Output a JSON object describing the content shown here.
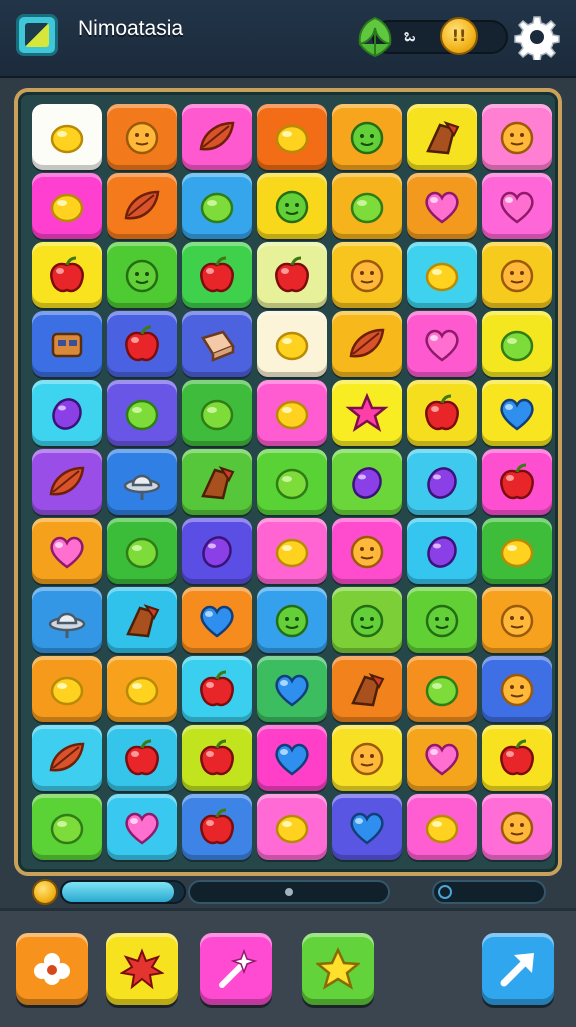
{
  "header": {
    "title": "Nimoatasia",
    "resource_count": "ಒ",
    "resource_icon": "leaf-icon",
    "coin_glyph": "!!",
    "coin_icon": "coin-icon",
    "settings_icon": "gear-icon"
  },
  "board": {
    "rows": 11,
    "cols": 7,
    "tiles": [
      [
        {
          "bg": "#fdfdf8",
          "icon": "lemon"
        },
        {
          "bg": "#f27a1c",
          "icon": "cookie"
        },
        {
          "bg": "#ff59cf",
          "icon": "leaf"
        },
        {
          "bg": "#f26d16",
          "icon": "lemon"
        },
        {
          "bg": "#f7a51d",
          "icon": "pea"
        },
        {
          "bg": "#f7e21f",
          "icon": "star-chip"
        },
        {
          "bg": "#ff7fd3",
          "icon": "cookie"
        }
      ],
      [
        {
          "bg": "#ff3fcf",
          "icon": "lemon"
        },
        {
          "bg": "#f57a1b",
          "icon": "leaf"
        },
        {
          "bg": "#35a6ec",
          "icon": "lime"
        },
        {
          "bg": "#f9d81c",
          "icon": "pea"
        },
        {
          "bg": "#f7b31c",
          "icon": "lime"
        },
        {
          "bg": "#f39a1e",
          "icon": "heart"
        },
        {
          "bg": "#ff66d8",
          "icon": "heart"
        }
      ],
      [
        {
          "bg": "#f9e31e",
          "icon": "apple"
        },
        {
          "bg": "#4ecb33",
          "icon": "pea"
        },
        {
          "bg": "#3fd04c",
          "icon": "apple"
        },
        {
          "bg": "#e7f19a",
          "icon": "apple"
        },
        {
          "bg": "#f7c51e",
          "icon": "cookie"
        },
        {
          "bg": "#3ed2ee",
          "icon": "lemon"
        },
        {
          "bg": "#f7ca1e",
          "icon": "cookie"
        }
      ],
      [
        {
          "bg": "#3b6fe3",
          "icon": "robot"
        },
        {
          "bg": "#4a62e1",
          "icon": "apple"
        },
        {
          "bg": "#4d62df",
          "icon": "gift"
        },
        {
          "bg": "#fbf4d8",
          "icon": "lemon"
        },
        {
          "bg": "#f7b81c",
          "icon": "leaf"
        },
        {
          "bg": "#ff59d0",
          "icon": "heart"
        },
        {
          "bg": "#f5e71f",
          "icon": "lime"
        }
      ],
      [
        {
          "bg": "#3ed4f0",
          "icon": "gem"
        },
        {
          "bg": "#6a56e6",
          "icon": "lime"
        },
        {
          "bg": "#3fbc3c",
          "icon": "lime"
        },
        {
          "bg": "#ff5cd1",
          "icon": "lemon"
        },
        {
          "bg": "#f8ed22",
          "icon": "star"
        },
        {
          "bg": "#f5de1e",
          "icon": "apple"
        },
        {
          "bg": "#f8e51f",
          "icon": "blueheart"
        }
      ],
      [
        {
          "bg": "#9a4ee8",
          "icon": "leaf"
        },
        {
          "bg": "#2f7fe4",
          "icon": "ufo"
        },
        {
          "bg": "#56c73a",
          "icon": "star-chip"
        },
        {
          "bg": "#59d236",
          "icon": "lime"
        },
        {
          "bg": "#6ad63a",
          "icon": "gem"
        },
        {
          "bg": "#3ec9ee",
          "icon": "gem"
        },
        {
          "bg": "#ff4fd1",
          "icon": "apple"
        }
      ],
      [
        {
          "bg": "#f5a11c",
          "icon": "heart"
        },
        {
          "bg": "#3bbd3a",
          "icon": "lime"
        },
        {
          "bg": "#5a4ee4",
          "icon": "gem"
        },
        {
          "bg": "#ff64d2",
          "icon": "lemon"
        },
        {
          "bg": "#ff4bce",
          "icon": "cookie"
        },
        {
          "bg": "#35c6ef",
          "icon": "gem"
        },
        {
          "bg": "#3dbd3a",
          "icon": "lemon"
        }
      ],
      [
        {
          "bg": "#3497e6",
          "icon": "ufo"
        },
        {
          "bg": "#30c2ea",
          "icon": "star-chip"
        },
        {
          "bg": "#f58c1d",
          "icon": "blueheart"
        },
        {
          "bg": "#35a1ec",
          "icon": "pea"
        },
        {
          "bg": "#7ccf36",
          "icon": "pea"
        },
        {
          "bg": "#60d035",
          "icon": "pea"
        },
        {
          "bg": "#f7a21e",
          "icon": "cookie"
        }
      ],
      [
        {
          "bg": "#f59a1b",
          "icon": "lemon"
        },
        {
          "bg": "#f7a11d",
          "icon": "lemon"
        },
        {
          "bg": "#3acfee",
          "icon": "apple"
        },
        {
          "bg": "#3cbd60",
          "icon": "blueheart"
        },
        {
          "bg": "#f2821b",
          "icon": "star-chip"
        },
        {
          "bg": "#f58f1d",
          "icon": "lime"
        },
        {
          "bg": "#3f6fe4",
          "icon": "cookie"
        }
      ],
      [
        {
          "bg": "#3ecff0",
          "icon": "leaf"
        },
        {
          "bg": "#35c5ea",
          "icon": "apple"
        },
        {
          "bg": "#c2e41f",
          "icon": "apple"
        },
        {
          "bg": "#ff3fc7",
          "icon": "blueheart"
        },
        {
          "bg": "#f8e124",
          "icon": "cookie"
        },
        {
          "bg": "#f5a51b",
          "icon": "heart"
        },
        {
          "bg": "#f8e21f",
          "icon": "apple"
        }
      ],
      [
        {
          "bg": "#5bd236",
          "icon": "lime"
        },
        {
          "bg": "#39c9f0",
          "icon": "heart"
        },
        {
          "bg": "#3d84e6",
          "icon": "apple"
        },
        {
          "bg": "#ff6ad5",
          "icon": "lemon"
        },
        {
          "bg": "#5a56e4",
          "icon": "blueheart"
        },
        {
          "bg": "#ff5ed2",
          "icon": "lemon"
        },
        {
          "bg": "#ff6dd6",
          "icon": "cookie"
        }
      ]
    ]
  },
  "progress": {
    "primary_fill": 0.92,
    "secondary_marker": 0.5
  },
  "powerups": [
    {
      "name": "powerup-flower-button",
      "bg": "#f7931c",
      "icon": "flower-icon"
    },
    {
      "name": "powerup-bomb-button",
      "bg": "#f7e21f",
      "icon": "splat-icon"
    },
    {
      "name": "powerup-wand-button",
      "bg": "#ff4bd1",
      "icon": "wand-icon"
    },
    {
      "name": "powerup-star-button",
      "bg": "#62d33a",
      "icon": "star-icon"
    },
    {
      "name": "powerup-arrow-button",
      "bg": "#2fa6ee",
      "icon": "arrow-icon"
    }
  ]
}
